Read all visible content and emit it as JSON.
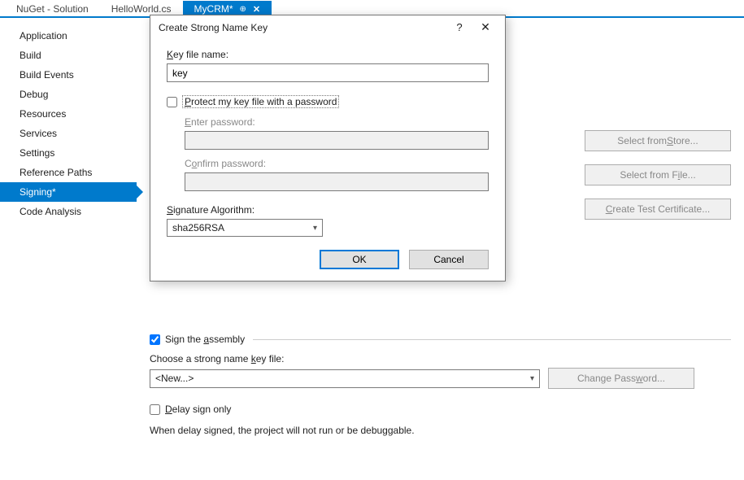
{
  "tabs": [
    {
      "label": "NuGet - Solution"
    },
    {
      "label": "HelloWorld.cs"
    },
    {
      "label": "MyCRM*"
    }
  ],
  "sidebar": {
    "items": [
      {
        "label": "Application"
      },
      {
        "label": "Build"
      },
      {
        "label": "Build Events"
      },
      {
        "label": "Debug"
      },
      {
        "label": "Resources"
      },
      {
        "label": "Services"
      },
      {
        "label": "Settings"
      },
      {
        "label": "Reference Paths"
      },
      {
        "label": "Signing*"
      },
      {
        "label": "Code Analysis"
      }
    ]
  },
  "background": {
    "buttons": {
      "selectFromStore": "Select from Store...",
      "selectFromFile": "Select from File...",
      "createTestCert": "Create Test Certificate...",
      "changePassword": "Change Password..."
    },
    "signAssemblySection": "Sign the assembly",
    "chooseKeyFileLabel": "Choose a strong name key file:",
    "keyFileSelectValue": "<New...>",
    "delaySignLabel": "Delay sign only",
    "delaySignNote": "When delay signed, the project will not run or be debuggable."
  },
  "dialog": {
    "title": "Create Strong Name Key",
    "keyFileNameLabel": "Key file name:",
    "keyFileNameValue": "key",
    "protectLabel": "Protect my key file with a password",
    "enterPasswordLabel": "Enter password:",
    "enterPasswordValue": "",
    "confirmPasswordLabel": "Confirm password:",
    "confirmPasswordValue": "",
    "algorithmLabel": "Signature Algorithm:",
    "algorithmValue": "sha256RSA",
    "okLabel": "OK",
    "cancelLabel": "Cancel"
  }
}
